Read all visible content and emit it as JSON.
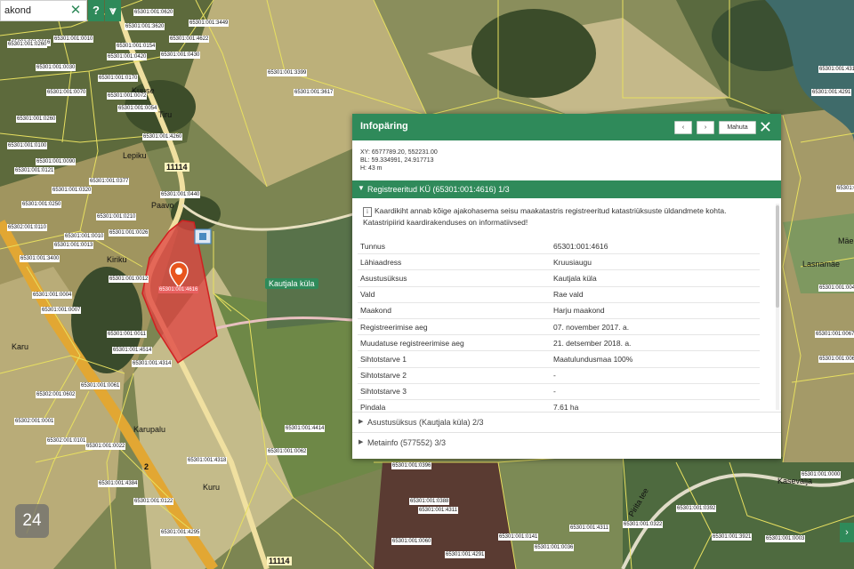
{
  "search": {
    "value": "akond",
    "clear_icon": "close-icon"
  },
  "toolbar": {
    "help_label": "?",
    "collapse_label": "⩔"
  },
  "map": {
    "place_label": "Kautjala küla",
    "street_labels": [
      "Lepiku",
      "Kuuse",
      "Tiru",
      "Paavo",
      "Kiriku",
      "Karu",
      "Kuru",
      "Karupalu",
      "Pirita tee",
      "Lasnamäe",
      "Kasevälja",
      "Mäe"
    ],
    "road_numbers": [
      "11114",
      "11114",
      "2"
    ],
    "parcel_labels": [
      "65301:001:0016",
      "65301:001:0010",
      "65301:001:3620",
      "65301:001:0620",
      "65301:001:4622",
      "65301:001:3449",
      "65301:001:0420",
      "65301:001:0430",
      "65301:001:3399",
      "65301:001:3617",
      "65301:001:4311",
      "65301:001:4291",
      "65301:001:0260",
      "65301:001:0154",
      "65301:001:0030",
      "65301:001:0170",
      "65301:001:0070",
      "65301:001:0072",
      "65301:001:0054",
      "65301:001:0260",
      "65301:001:0100",
      "65301:001:0090",
      "65301:001:4260",
      "65301:001:0121",
      "65301:001:0377",
      "65301:001:0320",
      "65301:001:0440",
      "65301:001:0250",
      "65301:001:0210",
      "65301:001:0010",
      "65302:001:0110",
      "65301:001:3400",
      "65301:001:0026",
      "65301:001:0012",
      "65301:001:0013",
      "65301:001:0007",
      "65301:001:0004",
      "65301:001:0011",
      "65301:001:4514",
      "65301:001:4314",
      "65301:001:0061",
      "65302:001:0602",
      "65302:001:0001",
      "65302:001:0101",
      "65301:001:0022",
      "65301:001:4384",
      "65301:001:0122",
      "65301:001:4295",
      "65301:001:4318",
      "65301:001:4414",
      "65301:001:0062",
      "65301:001:0396",
      "65301:001:0388",
      "65301:001:4311",
      "65301:001:0060",
      "65301:001:4291",
      "65301:001:0141",
      "65301:001:0036",
      "65301:001:4311",
      "65301:001:0322",
      "65301:001:0392",
      "65301:001:3921",
      "65301:001:0003",
      "65301:001:0000",
      "65301:001:0060",
      "65301:001:0067",
      "65301:001:0049",
      "65301:001:0104",
      "65301:001:4616"
    ],
    "marker_icon": "map-pin-icon",
    "colors": {
      "accent": "#2f8a5a",
      "parcel_outline": "#e8e060",
      "selected_fill": "#e04040",
      "road": "#e8b030"
    }
  },
  "panel": {
    "title": "Infopäring",
    "prev_label": "‹",
    "next_label": "›",
    "print_label": "Mahuta",
    "close_icon": "close-icon",
    "coords": {
      "xy": "XY: 6577789.20, 552231.00",
      "bl": "BL: 59.334991, 24.917713",
      "h": "H: 43 m"
    },
    "section1_title": "Registreeritud KÜ (65301:001:4616) 1/3",
    "info_icon": "i",
    "info_text": "Kaardikiht annab kõige ajakohasema seisu maakatastris registreeritud katastriüksuste üldandmete kohta. Katastripiirid kaardirakenduses on informatiivsed!",
    "rows": [
      {
        "key": "Tunnus",
        "value": "65301:001:4616"
      },
      {
        "key": "Lähiaadress",
        "value": "Kruusiaugu"
      },
      {
        "key": "Asustusüksus",
        "value": "Kautjala küla"
      },
      {
        "key": "Vald",
        "value": "Rae vald"
      },
      {
        "key": "Maakond",
        "value": "Harju maakond"
      },
      {
        "key": "Registreerimise aeg",
        "value": "07. november 2017. a."
      },
      {
        "key": "Muudatuse registreerimise aeg",
        "value": "21. detsember 2018. a."
      },
      {
        "key": "Sihtotstarve 1",
        "value": "Maatulundusmaa 100%"
      },
      {
        "key": "Sihtotstarve 2",
        "value": "-"
      },
      {
        "key": "Sihtotstarve 3",
        "value": "-"
      },
      {
        "key": "Pindala",
        "value": "7.61 ha"
      }
    ],
    "section2_title": "Asustusüksus (Kautjala küla) 2/3",
    "section3_title": "Metainfo (577552) 3/3"
  },
  "logo_text": "24",
  "side_button_label": "›"
}
